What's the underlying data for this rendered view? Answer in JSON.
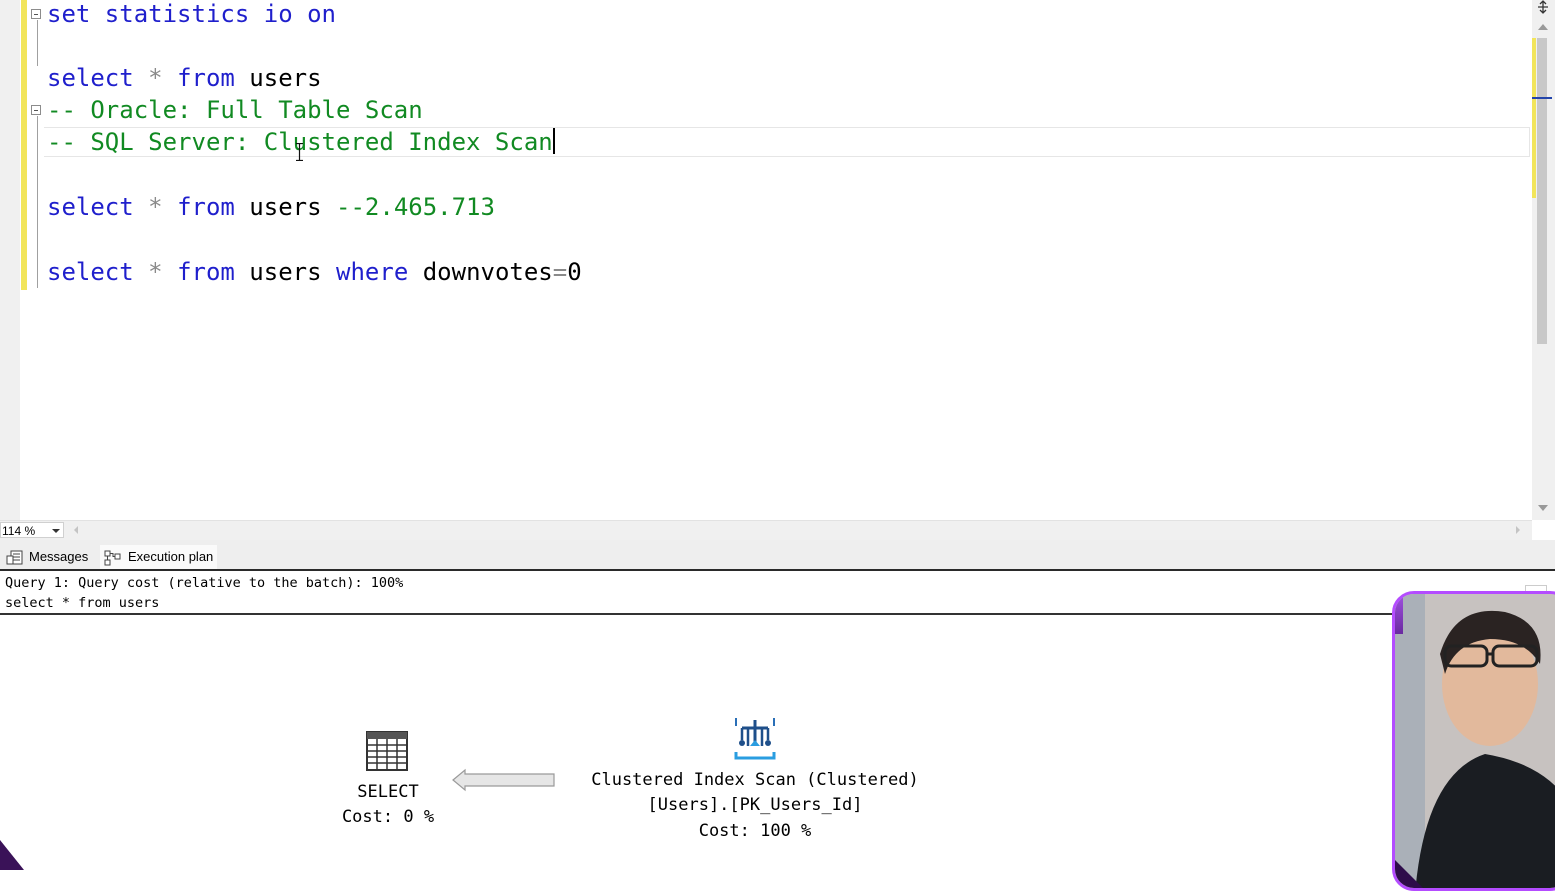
{
  "editor": {
    "lines": {
      "l1": {
        "t1": "set statistics io on"
      },
      "l2": {
        "k1": "select",
        "op": " * ",
        "k2": "from",
        "t": " users"
      },
      "l3": {
        "c": "-- Oracle: Full Table Scan"
      },
      "l4": {
        "c": "-- SQL Server: Clustered Index Scan"
      },
      "l5": {
        "k1": "select",
        "op": " * ",
        "k2": "from",
        "t": " users ",
        "c": "--2.465.713"
      },
      "l6": {
        "k1": "select",
        "op": " * ",
        "k2": "from",
        "t": " users ",
        "k3": "where",
        "t2": " downvotes",
        "op2": "=",
        "t3": "0"
      }
    },
    "zoom": "114 %"
  },
  "results": {
    "tabs": {
      "messages": "Messages",
      "execution_plan": "Execution plan"
    },
    "plan_header": {
      "query": "Query 1: Query cost (relative to the batch): 100%",
      "statement": "select * from users"
    },
    "nodes": {
      "select": {
        "name": "SELECT",
        "cost": "Cost: 0 %"
      },
      "scan": {
        "name": "Clustered Index Scan (Clustered)",
        "object": "[Users].[PK_Users_Id]",
        "cost": "Cost: 100 %"
      }
    }
  },
  "colors": {
    "keyword": "#1f1fcc",
    "comment": "#118a22",
    "changebar": "#f2e55a",
    "webcam_border": "#b44cff"
  }
}
